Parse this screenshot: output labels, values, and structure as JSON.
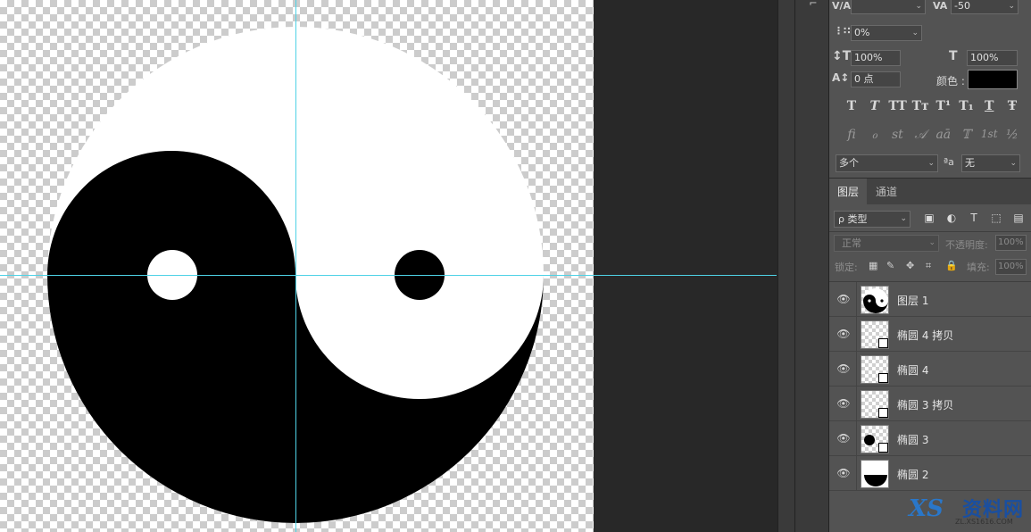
{
  "character_panel": {
    "kerning_value": "",
    "tracking_value": "-50",
    "tsume_value": "0%",
    "vertical_scale": "100%",
    "horizontal_scale": "100%",
    "baseline_shift": "0 点",
    "color_label": "颜色 :",
    "color_swatch": "#000000",
    "style_buttons": [
      "T",
      "T",
      "TT",
      "Tт",
      "T¹",
      "T₁",
      "T",
      "Ŧ"
    ],
    "opentype_buttons": [
      "fi",
      "ℴ",
      "st",
      "𝒜",
      "aā",
      "𝕋",
      "1st",
      "½"
    ],
    "language": "多个",
    "antialias_label": "ªa",
    "antialias": "无"
  },
  "layers_panel": {
    "tabs": [
      {
        "label": "图层",
        "active": true
      },
      {
        "label": "通道",
        "active": false
      }
    ],
    "filter_kind": "ρ 类型",
    "blend_mode": "正常",
    "opacity_label": "不透明度:",
    "opacity_value": "100%",
    "lock_label": "锁定:",
    "fill_label": "填充:",
    "fill_value": "100%",
    "layers": [
      {
        "name": "图层 1",
        "thumb": "yinyang",
        "visible": true
      },
      {
        "name": "椭圆 4 拷贝",
        "thumb": "empty-shape",
        "visible": true
      },
      {
        "name": "椭圆 4",
        "thumb": "empty-shape",
        "visible": true
      },
      {
        "name": "椭圆 3 拷贝",
        "thumb": "empty-shape",
        "visible": true
      },
      {
        "name": "椭圆 3",
        "thumb": "dot-shape",
        "visible": true
      },
      {
        "name": "椭圆 2",
        "thumb": "half-shape",
        "visible": true
      }
    ]
  },
  "watermark": {
    "text": "资料网",
    "sub": "ZL.XS1616.COM",
    "logo": "XS"
  },
  "colors": {
    "guide": "#4fd2e6",
    "panel_bg": "#535353",
    "pasteboard": "#282828"
  }
}
